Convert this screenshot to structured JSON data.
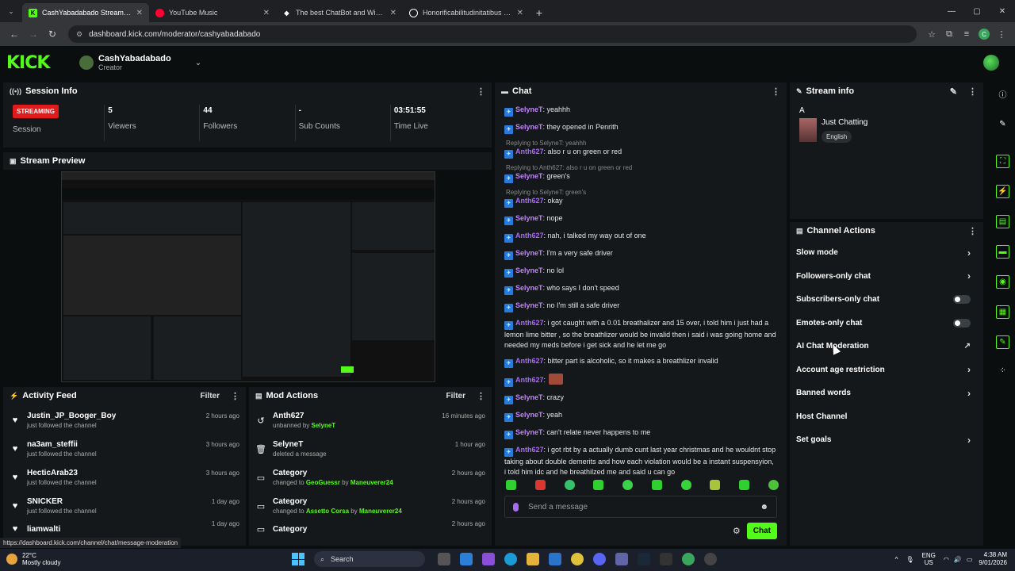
{
  "browser": {
    "tabs": [
      {
        "title": "CashYabadabado Stream - Kick",
        "active": true
      },
      {
        "title": "YouTube Music",
        "active": false
      },
      {
        "title": "The best ChatBot and Widgets",
        "active": false
      },
      {
        "title": "Honorificabilitudinitatibus - Go",
        "active": false
      }
    ],
    "url": "dashboard.kick.com/moderator/cashyabadabado",
    "profile_initial": "C",
    "status_url": "https://dashboard.kick.com/channel/chat/message-moderation"
  },
  "header": {
    "logo": "KICK",
    "channel_name": "CashYabadabado",
    "channel_role": "Creator"
  },
  "session": {
    "title": "Session Info",
    "status_badge": "STREAMING",
    "status_label": "Session",
    "viewers": {
      "value": "5",
      "label": "Viewers"
    },
    "followers": {
      "value": "44",
      "label": "Followers"
    },
    "subs": {
      "value": "-",
      "label": "Sub Counts"
    },
    "time": {
      "value": "03:51:55",
      "label": "Time Live"
    }
  },
  "preview": {
    "title": "Stream Preview"
  },
  "activity": {
    "title": "Activity Feed",
    "filter": "Filter",
    "items": [
      {
        "name": "Justin_JP_Booger_Boy",
        "desc": "just followed the channel",
        "time": "2 hours ago"
      },
      {
        "name": "na3am_steffii",
        "desc": "just followed the channel",
        "time": "3 hours ago"
      },
      {
        "name": "HecticArab23",
        "desc": "just followed the channel",
        "time": "3 hours ago"
      },
      {
        "name": "SNICKER",
        "desc": "just followed the channel",
        "time": "1 day ago"
      },
      {
        "name": "liamwalti",
        "desc": "",
        "time": "1 day ago"
      }
    ]
  },
  "mod": {
    "title": "Mod Actions",
    "filter": "Filter",
    "items": [
      {
        "name": "Anth627",
        "pre": "unbanned by ",
        "who": "SelyneT",
        "mid": "",
        "who2": "",
        "time": "16 minutes ago"
      },
      {
        "name": "SelyneT",
        "pre": "deleted a message",
        "who": "",
        "mid": "",
        "who2": "",
        "time": "1 hour ago"
      },
      {
        "name": "Category",
        "pre": "changed to ",
        "who": "GeoGuessr",
        "mid": " by ",
        "who2": "Maneuverer24",
        "time": "2 hours ago"
      },
      {
        "name": "Category",
        "pre": "changed to ",
        "who": "Assetto Corsa",
        "mid": " by ",
        "who2": "Maneuverer24",
        "time": "2 hours ago"
      },
      {
        "name": "Category",
        "pre": "",
        "who": "",
        "mid": "",
        "who2": "",
        "time": "2 hours ago"
      }
    ]
  },
  "chat": {
    "title": "Chat",
    "placeholder": "Send a message",
    "send_label": "Chat",
    "messages": [
      {
        "reply": "",
        "user": "SelyneT",
        "text": ": yeahhh"
      },
      {
        "reply": "",
        "user": "SelyneT",
        "text": ": they opened in Penrith"
      },
      {
        "reply": "Replying to SelyneT: yeahhh",
        "user": "Anth627",
        "text": ": also r u on green or red"
      },
      {
        "reply": "Replying to Anth627: also r u on green or red",
        "user": "SelyneT",
        "text": ": green's"
      },
      {
        "reply": "Replying to SelyneT: green's",
        "user": "Anth627",
        "text": ": okay"
      },
      {
        "reply": "",
        "user": "SelyneT",
        "text": ": nope"
      },
      {
        "reply": "",
        "user": "Anth627",
        "text": ": nah, i talked my way out of one"
      },
      {
        "reply": "",
        "user": "SelyneT",
        "text": ": I'm a very safe driver"
      },
      {
        "reply": "",
        "user": "SelyneT",
        "text": ": no lol"
      },
      {
        "reply": "",
        "user": "SelyneT",
        "text": ": who says I don't speed"
      },
      {
        "reply": "",
        "user": "SelyneT",
        "text": ": no I'm still a safe driver"
      },
      {
        "reply": "",
        "user": "Anth627",
        "text": ": i got caught with a 0.01 breathalizer and 15 over, i told him i just had a lemon lime bitter , so the breathlizer would be invalid then i said i was going home and needed my meds before i get sick and he let me go"
      },
      {
        "reply": "",
        "user": "Anth627",
        "text": ": bitter part is alcoholic, so it makes a breathlizer invalid"
      },
      {
        "reply": "",
        "user": "Anth627",
        "text": ":",
        "emote": true
      },
      {
        "reply": "",
        "user": "SelyneT",
        "text": ": crazy"
      },
      {
        "reply": "",
        "user": "SelyneT",
        "text": ": yeah"
      },
      {
        "reply": "",
        "user": "SelyneT",
        "text": ": can't relate never happens to me"
      },
      {
        "reply": "",
        "user": "Anth627",
        "text": ": i got rbt by a actually dumb cunt last year christmas and he wouldnt stop taking about double demerits and how each violation would be a instant suspensyion, i told him idc and he breathilzed me and said u can go"
      }
    ]
  },
  "stream_info": {
    "title": "Stream info",
    "stream_title": "A",
    "category": "Just Chatting",
    "language": "English"
  },
  "channel_actions": {
    "title": "Channel Actions",
    "items": [
      {
        "label": "Slow mode",
        "control": "chevron"
      },
      {
        "label": "Followers-only chat",
        "control": "chevron"
      },
      {
        "label": "Subscribers-only chat",
        "control": "toggle"
      },
      {
        "label": "Emotes-only chat",
        "control": "toggle"
      },
      {
        "label": "AI Chat Moderation",
        "control": "external"
      },
      {
        "label": "Account age restriction",
        "control": "chevron"
      },
      {
        "label": "Banned words",
        "control": "chevron"
      },
      {
        "label": "Host Channel",
        "control": "none"
      },
      {
        "label": "Set goals",
        "control": "chevron"
      }
    ]
  },
  "taskbar": {
    "temp": "22°C",
    "weather": "Mostly cloudy",
    "search": "Search",
    "lang1": "ENG",
    "lang2": "US",
    "time": "4:38 AM",
    "date": "9/01/2026"
  },
  "colors": {
    "accent": "#53fc18",
    "live": "#e01b1b",
    "user_a": "#c084fc",
    "user_b": "#a86cf2"
  }
}
